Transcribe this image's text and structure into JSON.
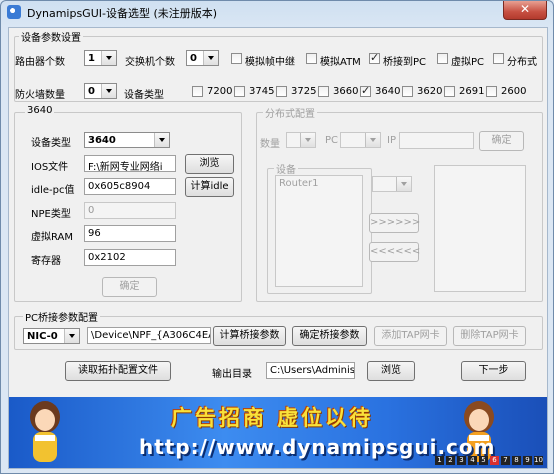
{
  "window": {
    "title": "DynamipsGUI-设备选型 (未注册版本)",
    "close_symbol": "✕"
  },
  "device_params": {
    "group_title": "设备参数设置",
    "router_count_label": "路由器个数",
    "router_count": "1",
    "switch_count_label": "交换机个数",
    "switch_count": "0",
    "frame_relay_label": "模拟帧中继",
    "frame_relay": false,
    "atm_label": "模拟ATM",
    "atm": false,
    "bridge_pc_label": "桥接到PC",
    "bridge_pc": true,
    "virtual_pc_label": "虚拟PC",
    "virtual_pc": false,
    "distributed_label": "分布式",
    "distributed": false,
    "firewall_count_label": "防火墙数量",
    "firewall_count": "0",
    "device_type_label": "设备类型",
    "device_types": [
      {
        "name": "7200",
        "checked": false
      },
      {
        "name": "3745",
        "checked": false
      },
      {
        "name": "3725",
        "checked": false
      },
      {
        "name": "3660",
        "checked": false
      },
      {
        "name": "3640",
        "checked": true
      },
      {
        "name": "3620",
        "checked": false
      },
      {
        "name": "2691",
        "checked": false
      },
      {
        "name": "2600",
        "checked": false
      }
    ]
  },
  "panel_3640": {
    "title": "3640",
    "device_type_label": "设备类型",
    "device_type": "3640",
    "ios_label": "IOS文件",
    "ios_value": "F:\\新网专业网络i",
    "browse_label": "浏览",
    "idlepc_label": "idle-pc值",
    "idlepc_value": "0x605c8904",
    "calc_idle_label": "计算idle",
    "npe_label": "NPE类型",
    "npe_value": "0",
    "ram_label": "虚拟RAM",
    "ram_value": "96",
    "register_label": "寄存器",
    "register_value": "0x2102",
    "ok_label": "确定"
  },
  "distributed": {
    "title": "分布式配置",
    "count_label": "数量",
    "pc_label": "PC",
    "ip_label": "IP",
    "ok_label": "确定",
    "device_group_title": "设备",
    "device_list": [
      "Router1"
    ],
    "move_right_label": ">>>>>>",
    "move_left_label": "<<<<<<"
  },
  "pc_bridge": {
    "title": "PC桥接参数配置",
    "nic": "NIC-0",
    "device_path": "\\Device\\NPF_{A306C4EA-",
    "calc_label": "计算桥接参数",
    "confirm_label": "确定桥接参数",
    "add_tap_label": "添加TAP网卡",
    "del_tap_label": "删除TAP网卡"
  },
  "bottom": {
    "read_topo_label": "读取拓扑配置文件",
    "output_dir_label": "输出目录",
    "output_dir": "C:\\Users\\Administ",
    "browse_label": "浏览",
    "next_label": "下一步"
  },
  "banner": {
    "headline": "广告招商 虚位以待",
    "url": "http://www.dynamipsgui.com",
    "pages": [
      "1",
      "2",
      "3",
      "4",
      "5",
      "6",
      "7",
      "8",
      "9",
      "10"
    ],
    "current_page": "6"
  }
}
